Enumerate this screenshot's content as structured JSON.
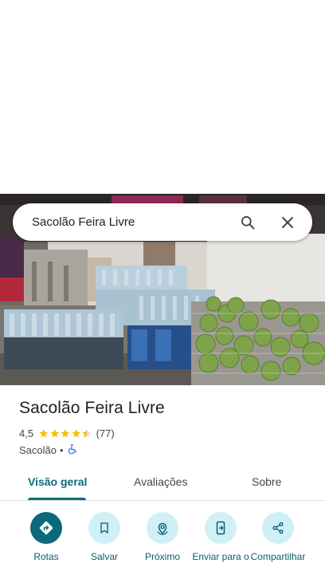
{
  "search": {
    "query": "Sacolão Feira Livre"
  },
  "place": {
    "name": "Sacolão Feira Livre",
    "rating": "4,5",
    "rating_stars": 4.5,
    "review_count": "(77)",
    "category": "Sacolão",
    "separator": "•"
  },
  "tabs": [
    {
      "label": "Visão geral",
      "active": true
    },
    {
      "label": "Avaliações",
      "active": false
    },
    {
      "label": "Sobre",
      "active": false
    }
  ],
  "actions": [
    {
      "label": "Rotas",
      "icon": "directions-icon"
    },
    {
      "label": "Salvar",
      "icon": "bookmark-icon"
    },
    {
      "label": "Próximo",
      "icon": "nearby-icon"
    },
    {
      "label": "Enviar para o",
      "icon": "send-to-phone-icon"
    },
    {
      "label": "Compartilhar",
      "icon": "share-icon"
    }
  ],
  "colors": {
    "accent": "#0b6a7a",
    "action_bg": "#cff0f7",
    "star": "#fbbc04",
    "accessible": "#1a73e8"
  }
}
